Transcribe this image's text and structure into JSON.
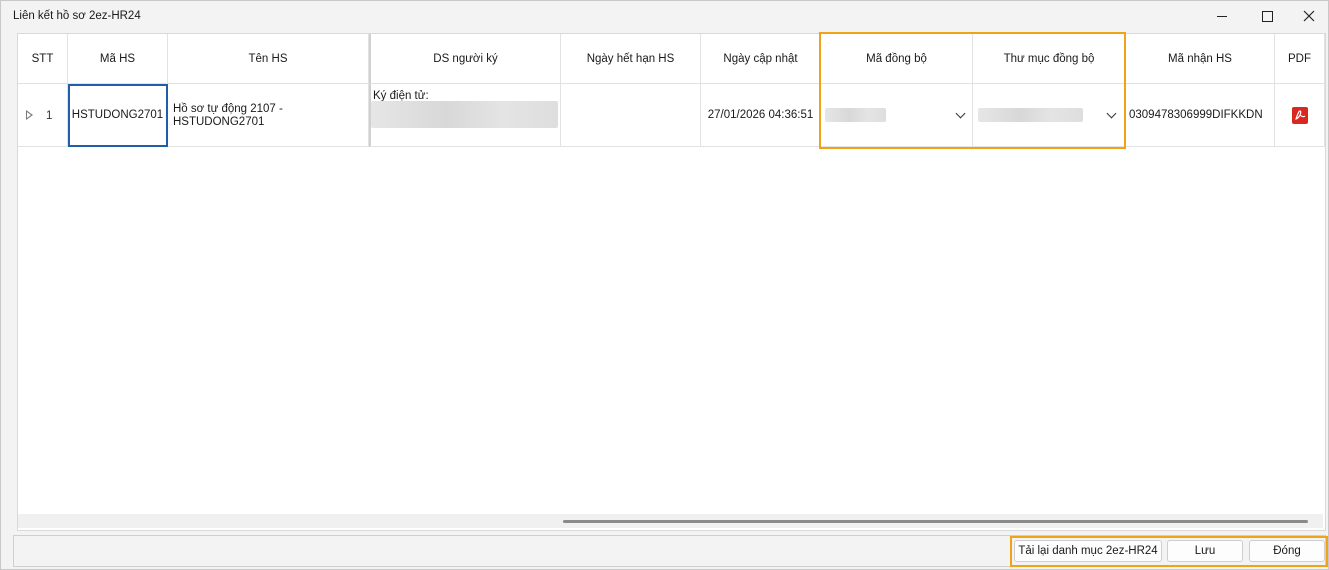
{
  "window": {
    "title": "Liên kết hồ sơ 2ez-HR24"
  },
  "columns": {
    "stt": "STT",
    "ma_hs": "Mã HS",
    "ten_hs": "Tên HS",
    "ds_nguoi_ky": "DS người ký",
    "ngay_het_han": "Ngày hết hạn HS",
    "ngay_cap_nhat": "Ngày cập nhật",
    "ma_dong_bo": "Mã đồng bộ",
    "thu_muc_dong_bo": "Thư mục đồng bộ",
    "ma_nhan_hs": "Mã nhận HS",
    "pdf": "PDF"
  },
  "rows": [
    {
      "stt": "1",
      "ma_hs": "HSTUDONG2701",
      "ten_hs_line1": "Hồ sơ tự động 2107 -",
      "ten_hs_line2": "HSTUDONG2701",
      "ds_nguoi_ky_label": "Ký điện tử:",
      "ngay_het_han": "",
      "ngay_cap_nhat": "27/01/2026 04:36:51",
      "ma_nhan_hs": "0309478306999DIFKKDN"
    }
  ],
  "icons": {
    "pdf": "pdf-icon",
    "expand": "expand-row-icon",
    "dropdown": "chevron-down-icon"
  },
  "buttons": {
    "reload": "Tải lại danh mục 2ez-HR24",
    "save": "Lưu",
    "close": "Đóng"
  },
  "colors": {
    "highlight": "#f0a21a",
    "selection": "#1e5fa8",
    "pdf": "#d8281f"
  }
}
